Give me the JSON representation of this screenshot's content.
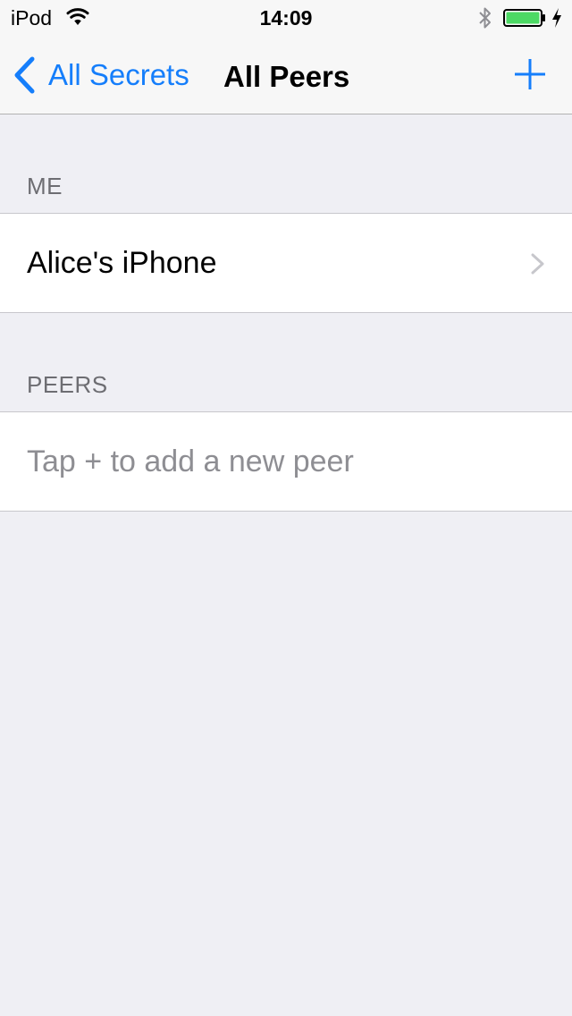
{
  "status_bar": {
    "carrier": "iPod",
    "time": "14:09",
    "icons": [
      "wifi-icon",
      "bluetooth-icon",
      "battery-icon",
      "charging-bolt-icon"
    ],
    "battery_color": "#4cd964"
  },
  "nav": {
    "back_label": "All Secrets",
    "title": "All Peers",
    "add_icon": "plus-icon",
    "tint_color": "#157efb"
  },
  "sections": {
    "me": {
      "header": "ME",
      "rows": [
        {
          "label": "Alice's iPhone",
          "accessory": "chevron-right-icon"
        }
      ]
    },
    "peers": {
      "header": "PEERS",
      "empty_text": "Tap + to add a new peer"
    }
  }
}
